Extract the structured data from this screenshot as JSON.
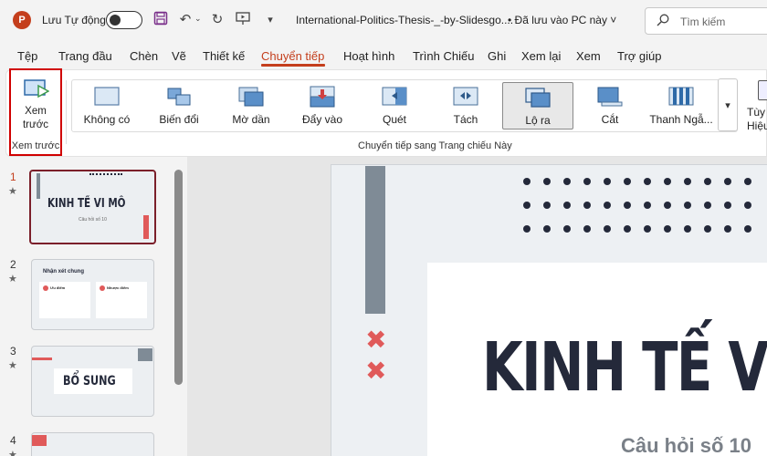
{
  "titlebar": {
    "app_logo": "P",
    "autosave_label": "Lưu Tự động",
    "doc_title": "International-Politics-Thesis-_-by-Slidesgo....",
    "saved_status": "• Đã lưu vào PC này ˅",
    "search_placeholder": "Tìm kiếm"
  },
  "menu": {
    "tabs": [
      "Tệp",
      "Trang đầu",
      "Chèn",
      "Vẽ",
      "Thiết kế",
      "Chuyển tiếp",
      "Hoạt hình",
      "Trình Chiếu",
      "Ghi",
      "Xem lại",
      "Xem",
      "Trợ giúp"
    ],
    "active_tab": "Chuyển tiếp"
  },
  "ribbon": {
    "preview_label": "Xem trước",
    "preview_group_label": "Xem trước",
    "transitions": [
      {
        "label": "Không có",
        "icon": "none-transition-icon"
      },
      {
        "label": "Biến đổi",
        "icon": "morph-transition-icon"
      },
      {
        "label": "Mờ dần",
        "icon": "fade-transition-icon"
      },
      {
        "label": "Đẩy vào",
        "icon": "push-transition-icon"
      },
      {
        "label": "Quét",
        "icon": "wipe-transition-icon"
      },
      {
        "label": "Tách",
        "icon": "split-transition-icon"
      },
      {
        "label": "Lộ ra",
        "icon": "reveal-transition-icon"
      },
      {
        "label": "Cắt",
        "icon": "cut-transition-icon"
      },
      {
        "label": "Thanh Ngẫ...",
        "icon": "random-bars-transition-icon"
      }
    ],
    "selected_transition": "Lộ ra",
    "effect_options_label_1": "Tùy",
    "effect_options_label_2": "Hiệu",
    "transition_group_label": "Chuyển tiếp sang Trang chiếu Này"
  },
  "thumbnails": [
    {
      "number": "1",
      "title": "KINH TẾ VI MÔ",
      "subtitle": "Câu hỏi số 10"
    },
    {
      "number": "2",
      "title": "Nhận xét chung",
      "col1": "Ưu điểm",
      "col2": "Nhược điểm"
    },
    {
      "number": "3",
      "title": "BỔ SUNG"
    },
    {
      "number": "4"
    }
  ],
  "slide": {
    "title": "KINH TẾ VI",
    "subtitle": "Câu hỏi số 10",
    "x_mark": "✖"
  },
  "colors": {
    "accent": "#c43e1c",
    "highlight_box": "#d00000",
    "slide_dark": "#24293a",
    "slide_red": "#e05a5a"
  }
}
